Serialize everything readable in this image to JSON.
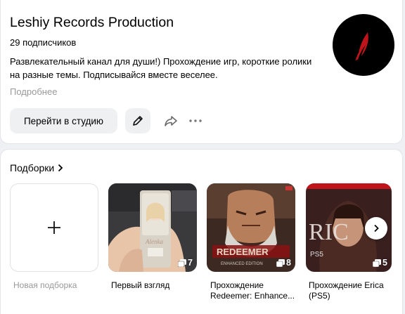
{
  "channel": {
    "title": "Leshiy Records Production",
    "subscribers": "29 подписчиков",
    "description": "Развлекательный канал для души!) Прохождение игр, короткие ролики на разные темы. Подписывайся вместе веселее.",
    "more_link": "Подробнее",
    "avatar_icon": "feather-logo"
  },
  "actions": {
    "studio_label": "Перейти в студию",
    "edit_icon": "pencil-icon",
    "share_icon": "share-arrow-icon",
    "more_icon": "more-dots-icon"
  },
  "collections": {
    "title": "Подборки",
    "new_label": "Новая подборка",
    "items": [
      {
        "label": "Первый взгляд",
        "count": "7"
      },
      {
        "label_line1": "Прохождение",
        "label_line2": "Redeemer: Enhance...",
        "count": "8"
      },
      {
        "label_line1": "Прохождение Erica",
        "label_line2": "(PS5)",
        "count": "5"
      }
    ]
  },
  "colors": {
    "accent_red": "#c0141a",
    "button_bg": "#eff0f2",
    "muted_text": "#999999"
  }
}
